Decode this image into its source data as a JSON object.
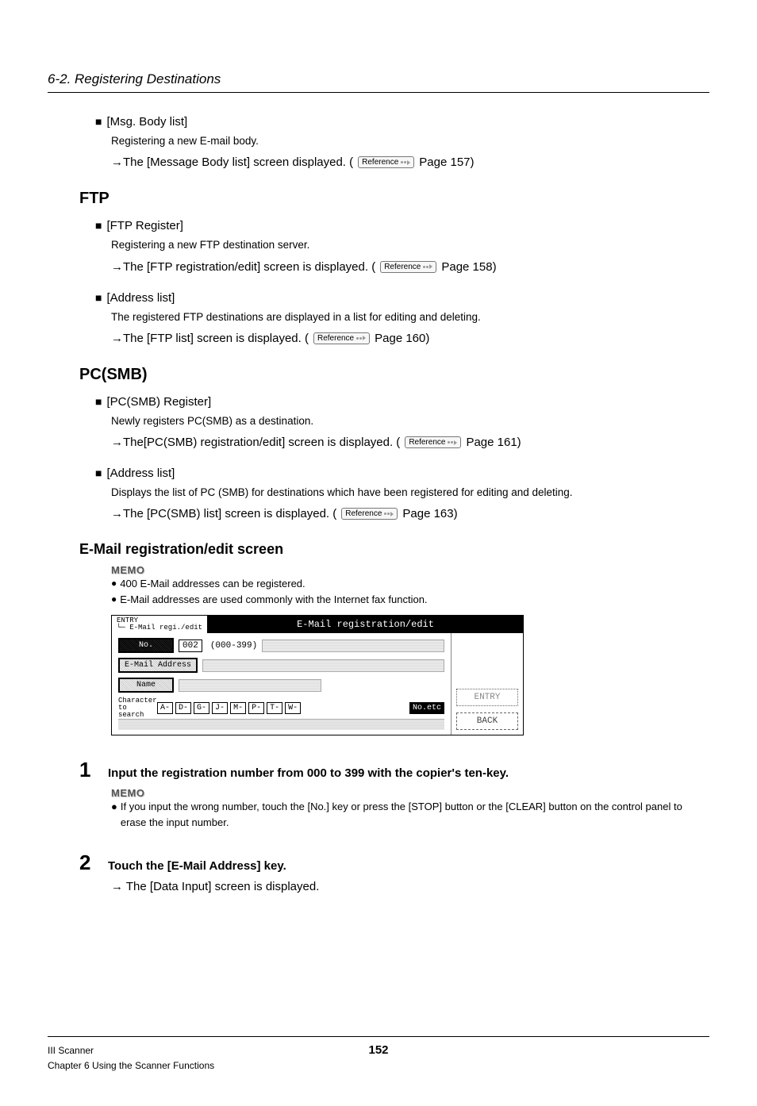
{
  "header_italic": "6-2. Registering Destinations",
  "msg_body": {
    "title": "[Msg. Body list]",
    "desc": "Registering a new E-mail body.",
    "arrow_prefix": "→The [Message Body list] screen displayed. (",
    "arrow_suffix": " Page 157)"
  },
  "ftp_heading": "FTP",
  "ftp_register": {
    "title": "[FTP Register]",
    "desc": "Registering a new FTP destination server.",
    "arrow_prefix": "→The [FTP registration/edit] screen is displayed. (",
    "arrow_suffix": " Page 158)"
  },
  "ftp_address": {
    "title": "[Address list]",
    "desc": "The registered FTP destinations are displayed in a list for editing and deleting.",
    "arrow_prefix": "→The [FTP list] screen is displayed. (",
    "arrow_suffix": " Page 160)"
  },
  "pcsmb_heading": "PC(SMB)",
  "pcsmb_register": {
    "title": "[PC(SMB) Register]",
    "desc": "Newly registers PC(SMB) as a destination.",
    "arrow_prefix": "→The[PC(SMB) registration/edit] screen is displayed. (",
    "arrow_suffix": " Page 161)"
  },
  "pcsmb_address": {
    "title": "[Address list]",
    "desc": "Displays the list of PC (SMB) for destinations which have been registered for editing and deleting.",
    "arrow_prefix": "→The [PC(SMB) list] screen is displayed. (",
    "arrow_suffix": " Page 163)"
  },
  "email_heading": "E-Mail registration/edit screen",
  "memo_label": "MEMO",
  "email_memo": [
    "400 E-Mail addresses can be registered.",
    "E-Mail addresses are used commonly with the Internet fax function."
  ],
  "reference_badge": "Reference",
  "lcd": {
    "crumb_top": "ENTRY",
    "crumb_bottom": "└─ E-Mail regi./edit",
    "title": "E-Mail registration/edit",
    "no_label": "No.",
    "no_value": "002",
    "no_range": "(000-399)",
    "email_label": "E-Mail Address",
    "name_label": "Name",
    "char_label_top": "Character",
    "char_label_bottom": "to search",
    "char_keys": [
      "A-",
      "D-",
      "G-",
      "J-",
      "M-",
      "P-",
      "T-",
      "W-"
    ],
    "char_sel": "No.etc",
    "btn_entry": "ENTRY",
    "btn_back": "BACK"
  },
  "step1": {
    "num": "1",
    "title": "Input the registration number from 000 to 399 with the copier's ten-key.",
    "memo": "If you input the wrong number, touch the [No.] key or press the [STOP] button or the [CLEAR] button on the control panel to erase the input number."
  },
  "step2": {
    "num": "2",
    "title": "Touch the [E-Mail Address] key.",
    "sub": "→ The [Data Input] screen is displayed."
  },
  "footer": {
    "line1": "III Scanner",
    "line2": "Chapter 6 Using the Scanner Functions",
    "page": "152"
  }
}
